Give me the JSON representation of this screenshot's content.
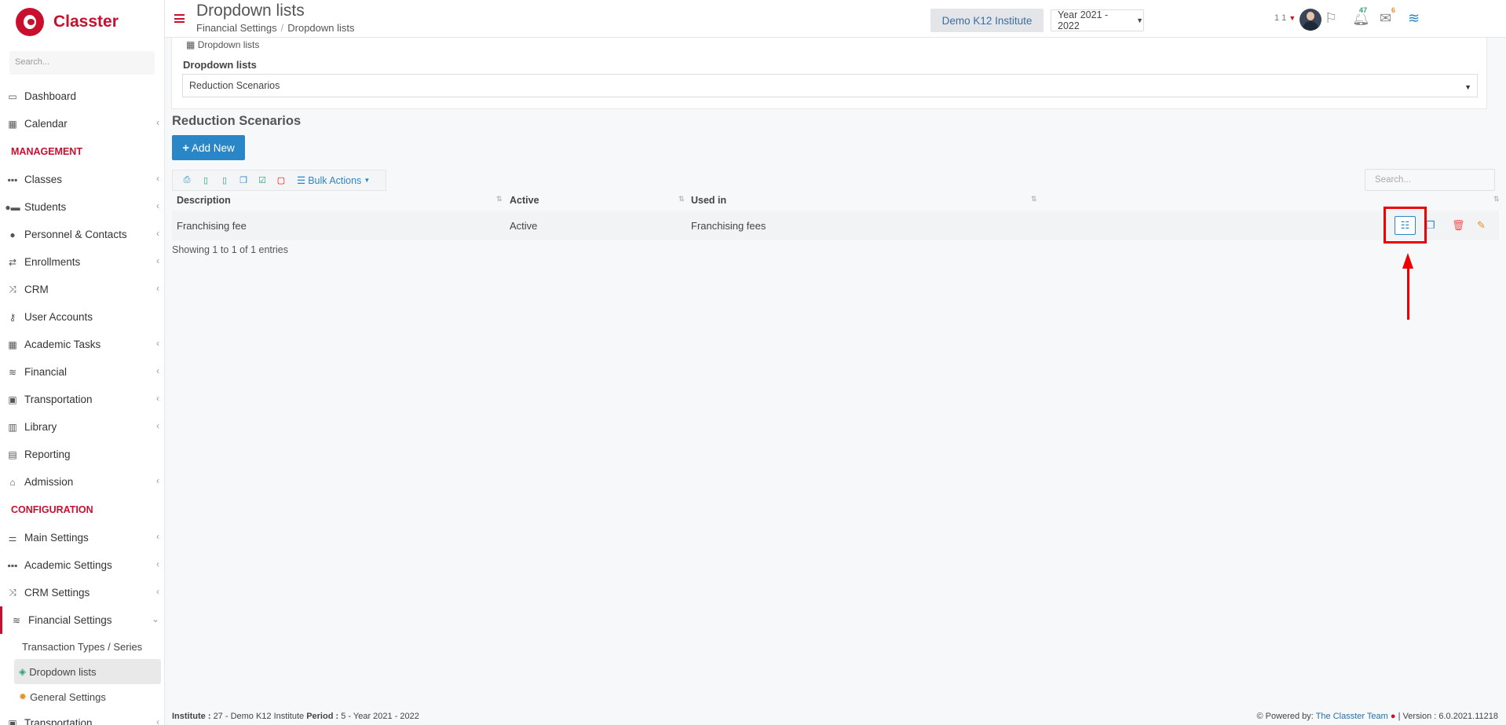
{
  "app": {
    "name": "Classter"
  },
  "sidebar": {
    "search_placeholder": "Search...",
    "items_top": [
      {
        "label": "Dashboard",
        "icon": "laptop-icon",
        "glyph": "▭",
        "chevron": false
      },
      {
        "label": "Calendar",
        "icon": "calendar-icon",
        "glyph": "▦",
        "chevron": true
      }
    ],
    "management_title": "MANAGEMENT",
    "management_items": [
      {
        "label": "Classes",
        "icon": "classes-icon",
        "glyph": "▪▪▪",
        "chevron": true
      },
      {
        "label": "Students",
        "icon": "students-icon",
        "glyph": "●▬",
        "chevron": true
      },
      {
        "label": "Personnel & Contacts",
        "icon": "personnel-icon",
        "glyph": "●",
        "chevron": true
      },
      {
        "label": "Enrollments",
        "icon": "enrollments-icon",
        "glyph": "⇄",
        "chevron": true
      },
      {
        "label": "CRM",
        "icon": "crm-icon",
        "glyph": "⤨",
        "chevron": true
      },
      {
        "label": "User Accounts",
        "icon": "key-icon",
        "glyph": "⚷",
        "chevron": false
      },
      {
        "label": "Academic Tasks",
        "icon": "academic-tasks-icon",
        "glyph": "▦",
        "chevron": true
      },
      {
        "label": "Financial",
        "icon": "financial-icon",
        "glyph": "≋",
        "chevron": true
      },
      {
        "label": "Transportation",
        "icon": "bus-icon",
        "glyph": "▣",
        "chevron": true
      },
      {
        "label": "Library",
        "icon": "library-icon",
        "glyph": "▥",
        "chevron": true
      },
      {
        "label": "Reporting",
        "icon": "printer-icon",
        "glyph": "▤",
        "chevron": false
      },
      {
        "label": "Admission",
        "icon": "admission-icon",
        "glyph": "⌂",
        "chevron": true
      }
    ],
    "configuration_title": "CONFIGURATION",
    "configuration_items": [
      {
        "label": "Main Settings",
        "icon": "sliders-icon",
        "glyph": "⚌",
        "chevron": true
      },
      {
        "label": "Academic Settings",
        "icon": "academic-settings-icon",
        "glyph": "▪▪▪",
        "chevron": true
      },
      {
        "label": "CRM Settings",
        "icon": "crm-settings-icon",
        "glyph": "⤨",
        "chevron": true
      }
    ],
    "financial_settings": {
      "label": "Financial Settings",
      "sub_items": [
        {
          "label": "Transaction Types / Series"
        },
        {
          "label": "Dropdown lists"
        },
        {
          "label": "General Settings"
        }
      ]
    },
    "bottom_item": {
      "label": "Transportation"
    }
  },
  "header": {
    "title": "Dropdown lists",
    "breadcrumb": [
      "Financial Settings",
      "Dropdown lists"
    ],
    "institute": "Demo K12 Institute",
    "year": "Year 2021 - 2022",
    "notifications_count": "47",
    "messages_count": "6",
    "user_count": "1 1"
  },
  "panel": {
    "label": "Dropdown lists",
    "field_label": "Dropdown lists",
    "selected": "Reduction Scenarios"
  },
  "main": {
    "section_title": "Reduction Scenarios",
    "add_new": "Add New",
    "bulk_actions": "Bulk Actions",
    "search_placeholder": "Search...",
    "columns": [
      "Description",
      "Active",
      "Used in"
    ],
    "rows": [
      {
        "description": "Franchising fee",
        "active": "Active",
        "used_in": "Franchising fees"
      }
    ],
    "entries": "Showing 1 to 1 of 1 entries"
  },
  "footer": {
    "institute_label": "Institute :",
    "institute_value": "27 - Demo K12 Institute",
    "period_label": "Period :",
    "period_value": "5 - Year 2021 - 2022",
    "powered_by": "Powered by:",
    "team": "The Classter Team",
    "version": "| Version : 6.0.2021.11218"
  },
  "colors": {
    "brand": "#c8102e",
    "accent": "#2a87c7",
    "highlight": "#ee0000"
  }
}
